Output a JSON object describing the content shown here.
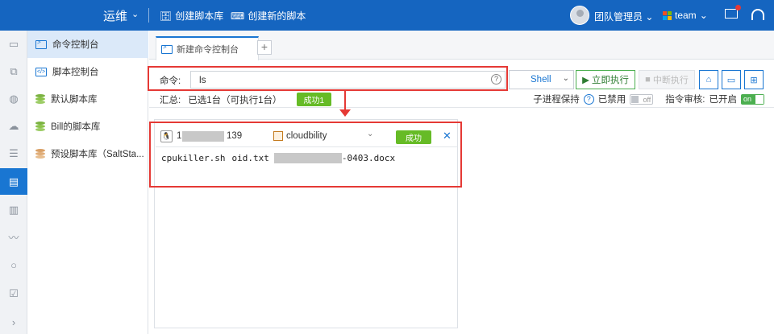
{
  "app": {
    "title": "运维",
    "create_script_lib": "创建脚本库",
    "create_new_script": "创建新的脚本",
    "user": "团队管理员",
    "team": "team"
  },
  "sidebar": {
    "items": [
      {
        "label": "命令控制台",
        "icon": "terminal-icon"
      },
      {
        "label": "脚本控制台",
        "icon": "code-icon"
      },
      {
        "label": "默认脚本库",
        "icon": "database-icon"
      },
      {
        "label": "Bill的脚本库",
        "icon": "database-icon"
      },
      {
        "label": "预设脚本库（SaltSta...",
        "icon": "database-icon"
      }
    ]
  },
  "tabs": [
    {
      "label": "新建命令控制台"
    }
  ],
  "command": {
    "label": "命令:",
    "value": "ls",
    "shell": "Shell",
    "run_label": "立即执行",
    "stop_label": "中断执行"
  },
  "summary": {
    "label": "汇总:",
    "text": "已选1台（可执行1台）",
    "badge": "成功1",
    "subprocess_label": "子进程保持",
    "subprocess_state": "已禁用",
    "subprocess_toggle": "off",
    "audit_label": "指令审核:",
    "audit_state": "已开启",
    "audit_toggle": "on"
  },
  "result": {
    "host_prefix": "1",
    "host_suffix": "139",
    "cloud": "cloudbility",
    "status": "成功",
    "output_files": [
      "cpukiller.sh",
      "oid.txt"
    ],
    "output_masked_suffix": "-0403.docx"
  },
  "colors": {
    "primary": "#1565c0",
    "success": "#66bb26",
    "highlight": "#e53935"
  }
}
